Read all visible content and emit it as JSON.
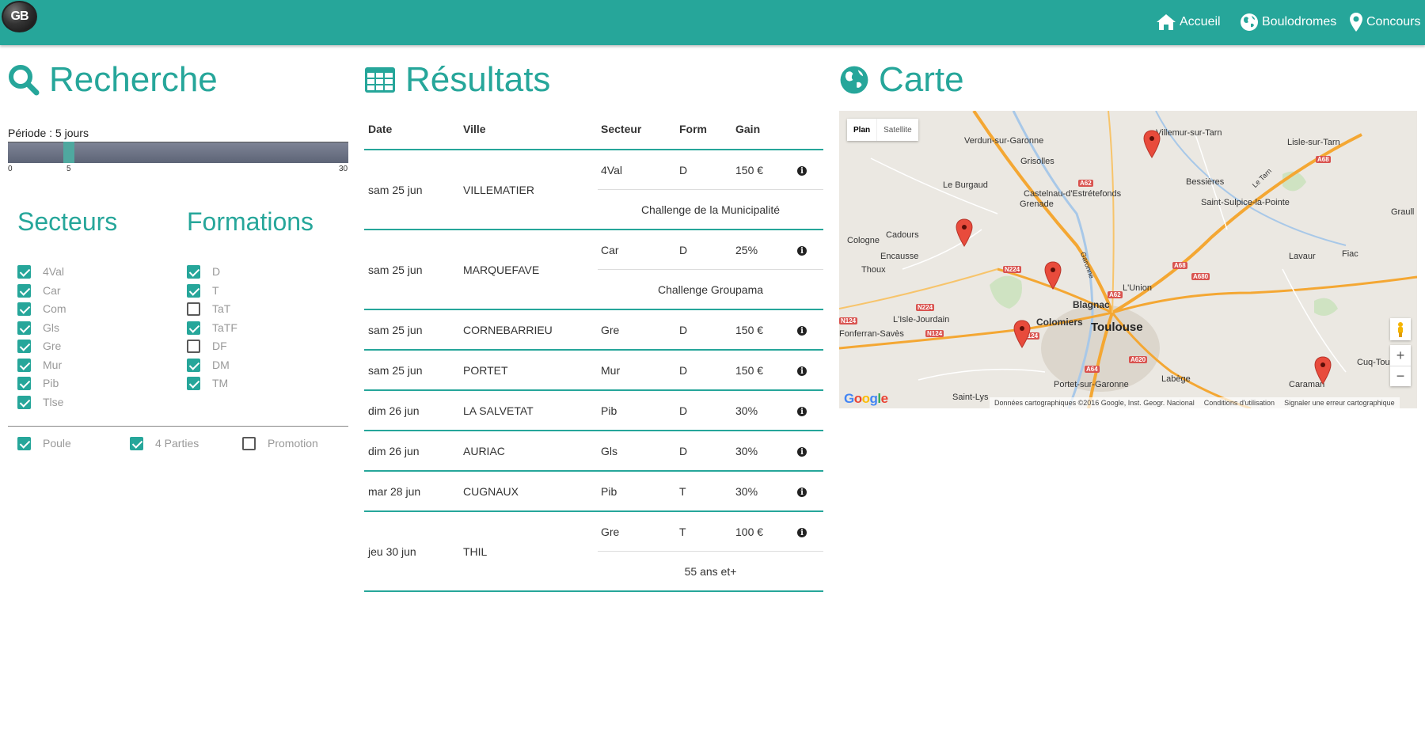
{
  "header": {
    "logo_text": "GB",
    "nav": [
      {
        "label": "Accueil",
        "icon": "home-icon"
      },
      {
        "label": "Boulodromes",
        "icon": "globe-icon"
      },
      {
        "label": "Concours",
        "icon": "map-marker-icon"
      }
    ]
  },
  "search": {
    "title": "Recherche",
    "period_label": "Période : 5 jours",
    "slider": {
      "min_label": "0",
      "value_label": "5",
      "max_label": "30",
      "min": 0,
      "max": 30,
      "value": 5
    },
    "sectors_title": "Secteurs",
    "formations_title": "Formations",
    "sectors": [
      {
        "label": "4Val",
        "checked": true
      },
      {
        "label": "Car",
        "checked": true
      },
      {
        "label": "Com",
        "checked": true
      },
      {
        "label": "Gls",
        "checked": true
      },
      {
        "label": "Gre",
        "checked": true
      },
      {
        "label": "Mur",
        "checked": true
      },
      {
        "label": "Pib",
        "checked": true
      },
      {
        "label": "Tlse",
        "checked": true
      }
    ],
    "formations": [
      {
        "label": "D",
        "checked": true
      },
      {
        "label": "T",
        "checked": true
      },
      {
        "label": "TaT",
        "checked": false
      },
      {
        "label": "TaTF",
        "checked": true
      },
      {
        "label": "DF",
        "checked": false
      },
      {
        "label": "DM",
        "checked": true
      },
      {
        "label": "TM",
        "checked": true
      }
    ],
    "options": [
      {
        "label": "Poule",
        "checked": true
      },
      {
        "label": "4 Parties",
        "checked": true
      },
      {
        "label": "Promotion",
        "checked": false
      }
    ]
  },
  "results": {
    "title": "Résultats",
    "columns": {
      "date": "Date",
      "ville": "Ville",
      "secteur": "Secteur",
      "form": "Form",
      "gain": "Gain"
    },
    "rows": [
      {
        "date": "sam 25 jun",
        "ville": "VILLEMATIER",
        "secteur": "4Val",
        "form": "D",
        "gain": "150 €",
        "note": "Challenge de la Municipalité"
      },
      {
        "date": "sam 25 jun",
        "ville": "MARQUEFAVE",
        "secteur": "Car",
        "form": "D",
        "gain": "25%",
        "note": "Challenge Groupama"
      },
      {
        "date": "sam 25 jun",
        "ville": "CORNEBARRIEU",
        "secteur": "Gre",
        "form": "D",
        "gain": "150 €",
        "note": ""
      },
      {
        "date": "sam 25 jun",
        "ville": "PORTET",
        "secteur": "Mur",
        "form": "D",
        "gain": "150 €",
        "note": ""
      },
      {
        "date": "dim 26 jun",
        "ville": "LA SALVETAT",
        "secteur": "Pib",
        "form": "D",
        "gain": "30%",
        "note": ""
      },
      {
        "date": "dim 26 jun",
        "ville": "AURIAC",
        "secteur": "Gls",
        "form": "D",
        "gain": "30%",
        "note": ""
      },
      {
        "date": "mar 28 jun",
        "ville": "CUGNAUX",
        "secteur": "Pib",
        "form": "T",
        "gain": "30%",
        "note": ""
      },
      {
        "date": "jeu 30 jun",
        "ville": "THIL",
        "secteur": "Gre",
        "form": "T",
        "gain": "100 €",
        "note": "55 ans et+"
      }
    ]
  },
  "map": {
    "title": "Carte",
    "toggle": {
      "plan": "Plan",
      "satellite": "Satellite"
    },
    "labels": [
      "Verdun-sur-Garonne",
      "Villemur-sur-Tarn",
      "Lisle-sur-Tarn",
      "Grisolles",
      "Le Burgaud",
      "Castelnau-d'Estrétefonds",
      "Grenade",
      "Bessières",
      "Saint-Sulpice-la-Pointe",
      "Graull",
      "Cologne",
      "Cadours",
      "Encausse",
      "Thoux",
      "L'Union",
      "Blagnac",
      "Lavaur",
      "Fiac",
      "L'Isle-Jourdain",
      "Colomiers",
      "Toulouse",
      "Fonferran-Savès",
      "Cuq-Toulza",
      "Labège",
      "Portet-sur-Garonne",
      "Caraman",
      "Saint-Lys",
      "Garonne",
      "Le Tarn"
    ],
    "roads": [
      "A62",
      "A68",
      "N224",
      "A62",
      "A68",
      "A680",
      "N124",
      "N224",
      "N124",
      "A620",
      "A64",
      "N124"
    ],
    "google_logo": "Google",
    "footer": [
      "Données cartographiques ©2016 Google, Inst. Geogr. Nacional",
      "Conditions d'utilisation",
      "Signaler une erreur cartographique"
    ],
    "zoom_in": "+",
    "zoom_out": "−",
    "marker_color": "#e84b3c"
  },
  "colors": {
    "accent": "#26a69a",
    "header_bg": "#26a69a",
    "marker": "#e84b3c"
  }
}
